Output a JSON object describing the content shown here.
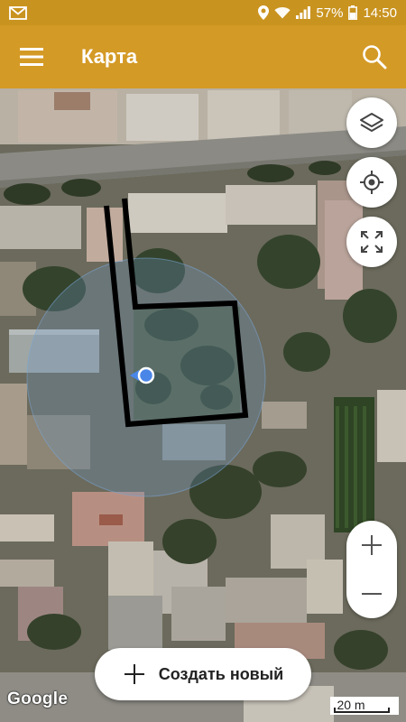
{
  "status_bar": {
    "app_icon": "gmail-icon",
    "battery_percent": "57%",
    "time": "14:50"
  },
  "app_bar": {
    "title": "Карта",
    "menu_icon": "menu-icon",
    "search_icon": "search-icon"
  },
  "map_controls": {
    "layers_icon": "layers-icon",
    "my_location_icon": "my-location-icon",
    "fullscreen_icon": "fullscreen-icon",
    "zoom_in_icon": "zoom-in-icon",
    "zoom_out_icon": "zoom-out-icon"
  },
  "create_button": {
    "label": "Создать новый",
    "icon": "plus-icon"
  },
  "attribution": {
    "logo": "Google"
  },
  "scale": {
    "label": "20 m"
  },
  "colors": {
    "status_bar": "#c9931f",
    "app_bar": "#d49a26",
    "location_dot": "#4a86e8",
    "boundary": "#000000"
  }
}
